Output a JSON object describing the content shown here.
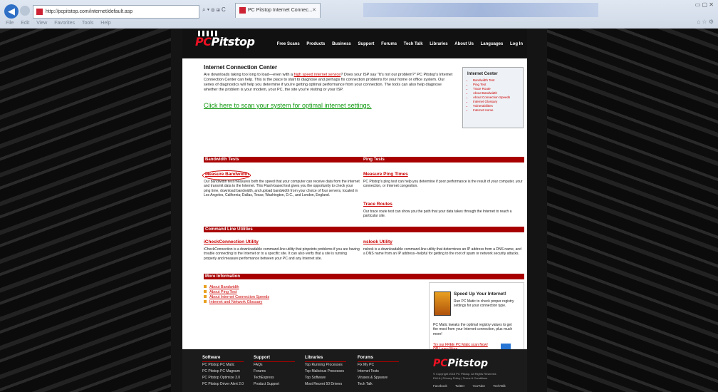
{
  "browser": {
    "address": "http://pcpitstop.com/internet/default.asp",
    "addr_tools": "⌕ ▾ ⊗ ⊞ C",
    "tab_title": "PC Pitstop Internet Connec...",
    "tab_close": "✕",
    "menu": [
      "File",
      "Edit",
      "View",
      "Favorites",
      "Tools",
      "Help"
    ],
    "win_controls": "▭ ▢ ✕",
    "right_icons": "⌂ ☆ ⚙"
  },
  "site": {
    "logo_a": "PC",
    "logo_b": "Pitstop",
    "nav": [
      "Free Scans",
      "Products",
      "Business",
      "Support",
      "Forums",
      "Tech Talk",
      "Libraries",
      "About Us",
      "Languages",
      "Log In"
    ]
  },
  "main": {
    "title": "Internet Connection Center",
    "intro_1": "Are downloads taking too long to load—even with a ",
    "intro_link": "high speed internet service",
    "intro_2": "? Does your ISP say \"It's not our problem?\" PC Pitstop's Internet Connection Center can help. This is the place to start to diagnose and perhaps fix connection problems for your home or office system. Our series of diagnostics will help you determine if you're getting optimal performance from your connection. The tools can also help diagnose whether the problem is your modem, your PC, the site you're visiting or your ISP.",
    "scan_link": "Click here to scan your system for optimal internet settings."
  },
  "internet_center": {
    "heading": "Internet Center",
    "links": [
      "Bandwidth Test",
      "Ping Test",
      "Trace Route",
      "About Bandwidth",
      "About Connection Speeds",
      "Internet Glossary",
      "Vulnerabilities",
      "Internet Home"
    ]
  },
  "sections": {
    "bandwidth_tests": "Bandwidth Tests",
    "ping_tests": "Ping Tests",
    "measure_bandwidth": "Measure Bandwidth",
    "measure_bandwidth_text": "Our bandwidth test measures both the speed that your computer can receive data from the internet and transmit data to the Internet. This Flash-based test gives you the opportunity to check your ping time, download bandwidth, and upload bandwidth from your choice of four servers, located in Los Angeles, California; Dallas, Texas; Washington, D.C., and London, England.",
    "measure_ping": "Measure Ping Times",
    "measure_ping_text": "PC Pitstop's ping test can help you determine if poor performance is the result of your computer, your connection, or Internet congestion.",
    "trace_routes": "Trace Routes",
    "trace_routes_text": "Our trace route test can show you the path that your data takes through the Internet to reach a particular site.",
    "command_line": "Command Line Utilities",
    "icheck": "iCheckConnection Utility",
    "icheck_text": "iCheckConnection is a downloadable command-line utility that pinpoints problems if you are having trouble connecting to the Internet or to a specific site. It can also verify that a site is running properly and measure performance between your PC and any Internet site.",
    "nslook": "nslook Utility",
    "nslook_text": "nslook is a downloadable command-line utility that determines an IP address from a DNS name, and a DNS name from an IP address--helpful for getting to the root of spam or network security attacks.",
    "more_info": "More Information",
    "more_links": [
      "About Bandwidth",
      "About Ping Test",
      "About Internet Connection Speeds",
      "Internet and Network Glossary"
    ]
  },
  "promo": {
    "heading": "Speed Up Your Internet!",
    "text1": "Run PC Matic to check proper registry settings for your connection type.",
    "text2": "PC Matic tweaks the optimal registry values to get the most from your Internet connection, plus much more!",
    "cta": "Try our FREE PC Matic scan Now! OR Learn More"
  },
  "footer": {
    "software": {
      "heading": "Software",
      "items": [
        "PC Pitstop PC Matic",
        "PC Pitstop PC Magnum",
        "PC Pitstop Optimize 3.0",
        "PC Pitstop Driver Alert 2.0"
      ]
    },
    "support": {
      "heading": "Support",
      "items": [
        "FAQs",
        "Forums",
        "TechExpress",
        "Product Support"
      ]
    },
    "libraries": {
      "heading": "Libraries",
      "items": [
        "Top Running Processes",
        "Top Malicious Processes",
        "Top Software",
        "Most Recent 50 Drivers"
      ]
    },
    "forums": {
      "heading": "Forums",
      "items": [
        "Fix My PC",
        "Internet Tests",
        "Viruses & Spyware",
        "Tech Talk"
      ]
    },
    "copyright": "© Copyright 2015 PC Pitstop. All Rights Reserved.",
    "legal": "EULA | Privacy Policy | Terms & Conditions",
    "social": [
      "Facebook",
      "Twitter",
      "YouTube",
      "TechTalk"
    ]
  }
}
